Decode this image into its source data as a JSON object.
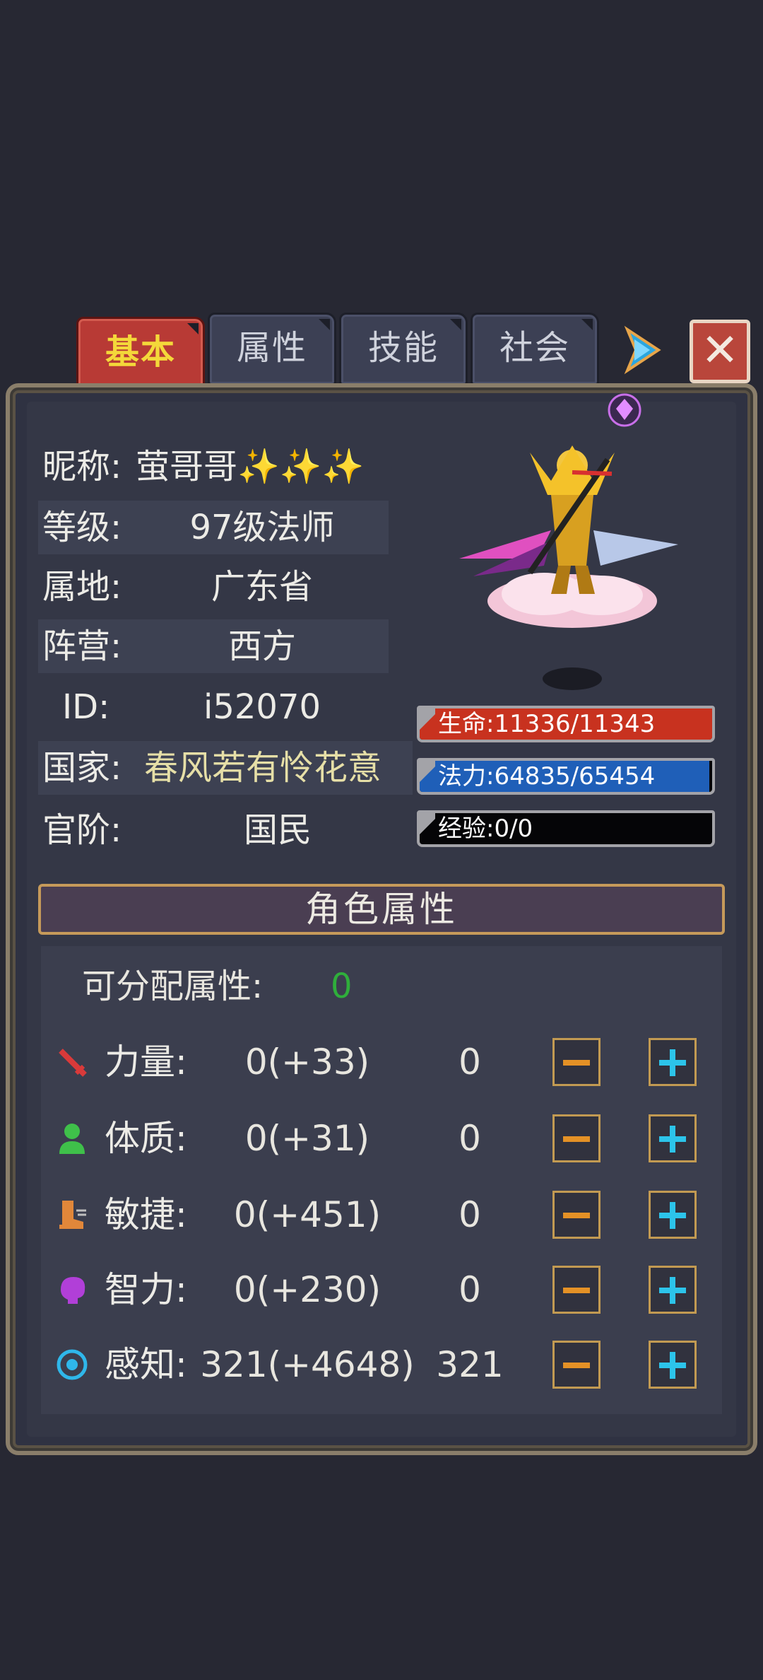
{
  "tabs": [
    {
      "label": "基本",
      "active": true
    },
    {
      "label": "属性",
      "active": false
    },
    {
      "label": "技能",
      "active": false
    },
    {
      "label": "社会",
      "active": false
    }
  ],
  "header_icons": {
    "next": "arrow-right-icon",
    "close": "close-icon"
  },
  "close_glyph": "✕",
  "profile": {
    "nickname_label": "昵称:",
    "nickname": "萤哥哥✨✨✨",
    "level_label": "等级:",
    "level": "97级法师",
    "region_label": "属地:",
    "region": "广东省",
    "camp_label": "阵营:",
    "camp": "西方",
    "id_label": "ID:",
    "id": "i52070",
    "nation_label": "国家:",
    "nation": "春风若有怜花意",
    "rank_label": "官阶:",
    "rank": "国民"
  },
  "bars": {
    "hp": {
      "text": "生命:11336/11343",
      "fraction": 0.999,
      "color": "#c8321f"
    },
    "mp": {
      "text": "法力:64835/65454",
      "fraction": 0.99,
      "color": "#1f5fb8"
    },
    "exp": {
      "text": "经验:0/0",
      "fraction": 0,
      "color": "#1a1a1a"
    }
  },
  "attributes": {
    "title": "角色属性",
    "points_label": "可分配属性:",
    "points_value": "0",
    "rows": [
      {
        "icon": "sword-icon",
        "label": "力量:",
        "base": "0(+33)",
        "alloc": "0"
      },
      {
        "icon": "person-icon",
        "label": "体质:",
        "base": "0(+31)",
        "alloc": "0"
      },
      {
        "icon": "boot-icon",
        "label": "敏捷:",
        "base": "0(+451)",
        "alloc": "0"
      },
      {
        "icon": "brain-icon",
        "label": "智力:",
        "base": "0(+230)",
        "alloc": "0"
      },
      {
        "icon": "eye-ring-icon",
        "label": "感知:",
        "base": "321(+4648)",
        "alloc": "321"
      }
    ]
  },
  "colors": {
    "tab_active": "#b83a35",
    "tab_active_text": "#f4d83a",
    "points_green": "#2fae3b",
    "minus": "#e49126",
    "plus": "#2cc4ea"
  }
}
